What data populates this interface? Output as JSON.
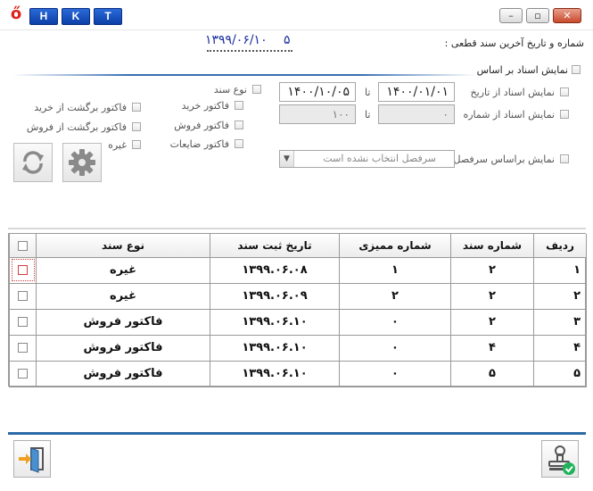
{
  "titlebar": {
    "hkt": [
      "H",
      "K",
      "T"
    ],
    "minimize": "–",
    "maximize": "▫",
    "close": "✕"
  },
  "header": {
    "last_doc_label": "شماره و تاریخ آخرین سند قطعی :",
    "last_doc_date": "۱۳۹۹/۰۶/۱۰",
    "last_doc_number": "۵"
  },
  "filters": {
    "show_by_label": "نمایش اسناد بر اساس",
    "from_date_label": "نمایش اسناد از تاریخ",
    "from_date": "۱۴۰۰/۰۱/۰۱",
    "to_date": "۱۴۰۰/۱۰/۰۵",
    "to_label_1": "تا",
    "from_number_label": "نمایش اسناد از شماره",
    "from_number": "۰",
    "to_number": "۱۰۰",
    "to_label_2": "تا",
    "doc_type_label": "نوع سند",
    "purchase_invoice": "فاکتور خرید",
    "purchase_return": "فاکتور برگشت از خرید",
    "sales_invoice": "فاکتور فروش",
    "sales_return": "فاکتور برگشت از فروش",
    "waste_invoice": "فاکتور ضایعات",
    "other": "غیره",
    "by_heading_label": "نمایش براساس سرفصل",
    "heading_placeholder": "سرفصل انتخاب نشده است"
  },
  "grid": {
    "columns": [
      "ردیف",
      "شماره سند",
      "شماره ممیزی",
      "تاریخ ثبت سند",
      "نوع سند"
    ],
    "rows": [
      [
        "۱",
        "۲",
        "۱",
        "۱۳۹۹.۰۶.۰۸",
        "غیره"
      ],
      [
        "۲",
        "۲",
        "۲",
        "۱۳۹۹.۰۶.۰۹",
        "غیره"
      ],
      [
        "۳",
        "۲",
        "۰",
        "۱۳۹۹.۰۶.۱۰",
        "فاکتور فروش"
      ],
      [
        "۴",
        "۴",
        "۰",
        "۱۳۹۹.۰۶.۱۰",
        "فاکتور فروش"
      ],
      [
        "۵",
        "۵",
        "۰",
        "۱۳۹۹.۰۶.۱۰",
        "فاکتور فروش"
      ]
    ]
  },
  "colors": {
    "accent": "#2c6aa6",
    "header_blue": "#1a2fa0",
    "logo_red": "#e0201b"
  }
}
